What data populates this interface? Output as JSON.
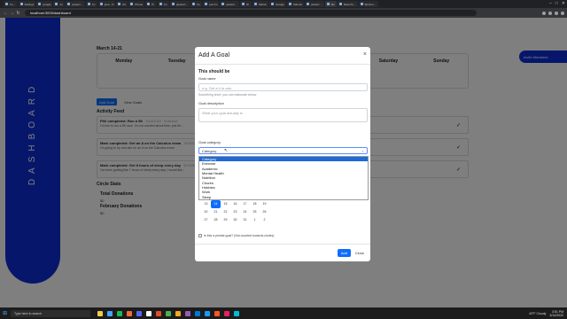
{
  "browser": {
    "tabs": [
      "Fu…",
      "Settings",
      "google",
      "Ju",
      "javascr…",
      "Fo",
      "java - hi",
      "Ro",
      "Phone",
      "Pi",
      "Fo",
      "javascri…",
      "Fo",
      "pos Fo",
      "javascr…",
      "W",
      "Marion",
      "Google",
      "Kahoot!",
      "javascr…",
      "Me",
      "React E…",
      "Spinner…"
    ],
    "active_tab_index": 20,
    "url": "localhost:3000/dashboard",
    "window_controls": [
      "–",
      "□",
      "✕"
    ]
  },
  "sidebar": {
    "title": "DASHBOARD"
  },
  "week": {
    "label": "March 14-21"
  },
  "days": [
    "Monday",
    "Tuesday",
    "Wednesday",
    "Thursday",
    "Friday",
    "Saturday",
    "Sunday"
  ],
  "actions": {
    "add_goal": "Add Goal",
    "view_goals": "View Goals"
  },
  "feed": {
    "title": "Activity Feed",
    "items": [
      {
        "name": "Phil",
        "action": "completed: Run a 5K",
        "date": "3/16/2022",
        "extra": "Exercise",
        "body": "I'd love to run a 5K race. I'm not worried about time, just fin…"
      },
      {
        "name": "Mark",
        "action": "completed: Get an A on the Calculus exam",
        "date": "3/15/2022",
        "extra": "Academic",
        "body": "I'm going to try and aim for an A on the Calculus exam"
      },
      {
        "name": "Mark",
        "action": "completed: Get 8 hours of sleep every day",
        "date": "3/14/2022",
        "extra": "Sleep",
        "body": "I've been getting like 7 hours of sleep every day, I would like…"
      }
    ]
  },
  "stats": {
    "title": "Circle Stats",
    "total_label": "Total Donations",
    "total_value": "$0",
    "feb_label": "February Donations",
    "feb_value": "$0"
  },
  "invite": {
    "label": "Invite Members"
  },
  "modal": {
    "title": "Add A Goal",
    "close_icon": "×",
    "section": "This should be",
    "name_label": "Goal name",
    "name_placeholder": "e.g. Get a 4 in calc",
    "name_help": "Something short, you can elaborate below",
    "desc_label": "Goal description",
    "desc_placeholder": "What your goal actually is",
    "category_label": "Goal category",
    "category_value": "Category",
    "category_options": [
      "Category",
      "Exercise",
      "Academic",
      "Mental Health",
      "Nutrition",
      "Chores",
      "Hobbies",
      "Work",
      "Sleep"
    ],
    "private_label": "Is this a private goal? (Not counted towards circles)",
    "add_button": "Add",
    "close_button": "Close"
  },
  "calendar": {
    "rows": [
      [
        "13",
        "14",
        "15",
        "16",
        "17",
        "18",
        "19"
      ],
      [
        "20",
        "21",
        "22",
        "23",
        "24",
        "25",
        "26"
      ],
      [
        "27",
        "28",
        "29",
        "30",
        "31",
        "1",
        "2"
      ]
    ],
    "today": "14"
  },
  "taskbar": {
    "search_placeholder": "Type here to search",
    "temperature": "43°F Cloudy",
    "time": "3:51 PM",
    "date": "3/14/2022",
    "app_colors": [
      "#f2c94c",
      "#4aa3ff",
      "#1db954",
      "#f26b3a",
      "#5865f2",
      "#ffffff",
      "#e34c26",
      "#4caf50",
      "#f5a623",
      "#9b59b6",
      "#0078d4",
      "#2196f3",
      "#ff5722",
      "#e91e63",
      "#00bcd4"
    ]
  }
}
